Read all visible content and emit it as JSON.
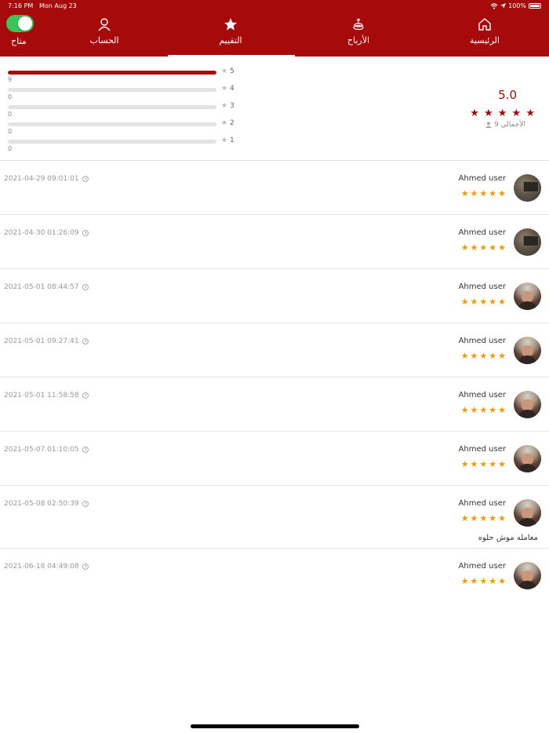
{
  "status_bar": {
    "time": "7:16 PM",
    "date": "Mon Aug 23",
    "battery": "100%"
  },
  "header": {
    "availability_label": "متاح",
    "availability_on": true,
    "accent_color": "#a60a0a",
    "tabs": [
      {
        "label": "الحساب",
        "icon": "user-icon"
      },
      {
        "label": "التقييم",
        "icon": "star-icon",
        "active": true
      },
      {
        "label": "الأرباح",
        "icon": "coins-icon"
      },
      {
        "label": "الرئيسية",
        "icon": "home-icon"
      }
    ]
  },
  "summary": {
    "average": "5.0",
    "average_stars": "★ ★ ★ ★ ★",
    "total": "9 الأجمالي",
    "distribution": [
      {
        "stars": "5",
        "count": "9",
        "fraction": 1.0
      },
      {
        "stars": "4",
        "count": "0",
        "fraction": 0
      },
      {
        "stars": "3",
        "count": "0",
        "fraction": 0
      },
      {
        "stars": "2",
        "count": "0",
        "fraction": 0
      },
      {
        "stars": "1",
        "count": "0",
        "fraction": 0
      }
    ]
  },
  "reviews": [
    {
      "name": "Ahmed user",
      "date": "2021-04-29 09:01:01",
      "stars": "★★★★★",
      "avatar": "room",
      "comment": ""
    },
    {
      "name": "Ahmed user",
      "date": "2021-04-30 01:26:09",
      "stars": "★★★★★",
      "avatar": "room",
      "comment": ""
    },
    {
      "name": "Ahmed user",
      "date": "2021-05-01 08:44:57",
      "stars": "★★★★★",
      "avatar": "man",
      "comment": ""
    },
    {
      "name": "Ahmed user",
      "date": "2021-05-01 09:27:41",
      "stars": "★★★★★",
      "avatar": "man",
      "comment": ""
    },
    {
      "name": "Ahmed user",
      "date": "2021-05-01 11:58:58",
      "stars": "★★★★★",
      "avatar": "man",
      "comment": ""
    },
    {
      "name": "Ahmed user",
      "date": "2021-05-07 01:10:05",
      "stars": "★★★★★",
      "avatar": "man",
      "comment": ""
    },
    {
      "name": "Ahmed user",
      "date": "2021-05-08 02:50:39",
      "stars": "★★★★★",
      "avatar": "man",
      "comment": "معامله موش حلوه"
    },
    {
      "name": "Ahmed user",
      "date": "2021-06-18 04:49:08",
      "stars": "★★★★★",
      "avatar": "man",
      "comment": ""
    }
  ]
}
